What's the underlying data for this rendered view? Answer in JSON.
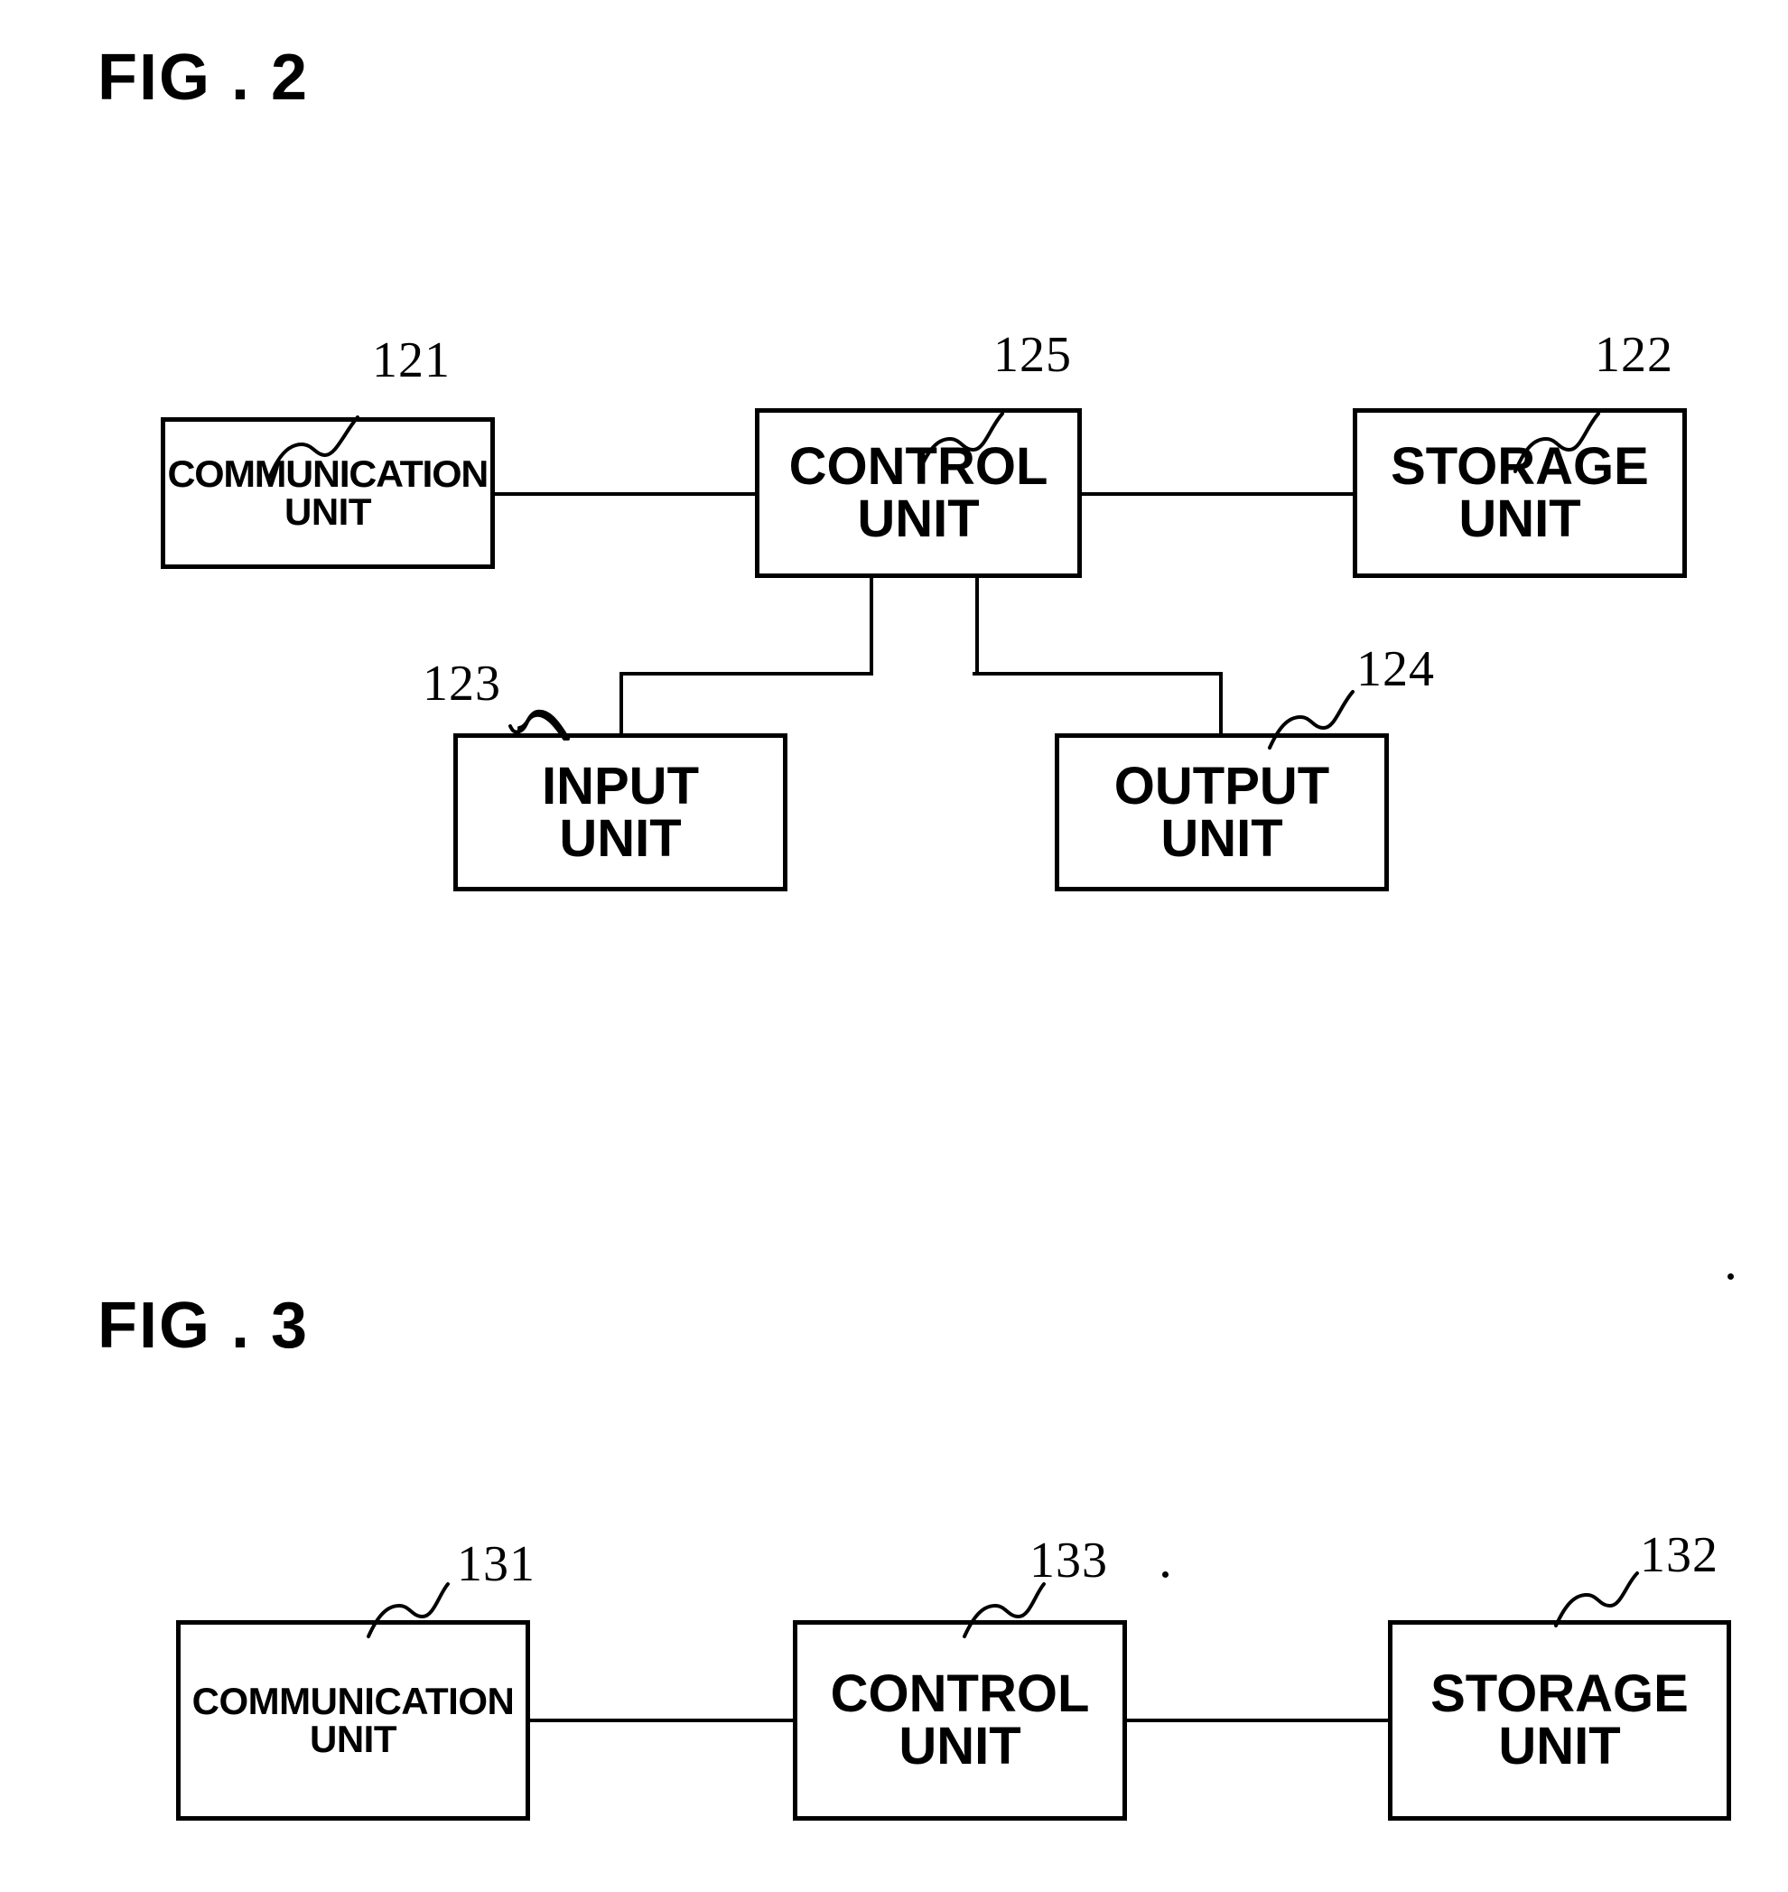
{
  "figures": [
    {
      "id": "fig2",
      "title": "FIG . 2",
      "boxes": {
        "communication": {
          "line1": "COMMUNICATION",
          "line2": "UNIT",
          "ref": "121"
        },
        "control": {
          "line1": "CONTROL",
          "line2": "UNIT",
          "ref": "125"
        },
        "storage": {
          "line1": "STORAGE",
          "line2": "UNIT",
          "ref": "122"
        },
        "input": {
          "line1": "INPUT",
          "line2": "UNIT",
          "ref": "123"
        },
        "output": {
          "line1": "OUTPUT",
          "line2": "UNIT",
          "ref": "124"
        }
      }
    },
    {
      "id": "fig3",
      "title": "FIG . 3",
      "boxes": {
        "communication": {
          "line1": "COMMUNICATION",
          "line2": "UNIT",
          "ref": "131"
        },
        "control": {
          "line1": "CONTROL",
          "line2": "UNIT",
          "ref": "133"
        },
        "storage": {
          "line1": "STORAGE",
          "line2": "UNIT",
          "ref": "132"
        }
      }
    }
  ],
  "colors": {
    "ink": "#000000",
    "paper": "#ffffff"
  }
}
